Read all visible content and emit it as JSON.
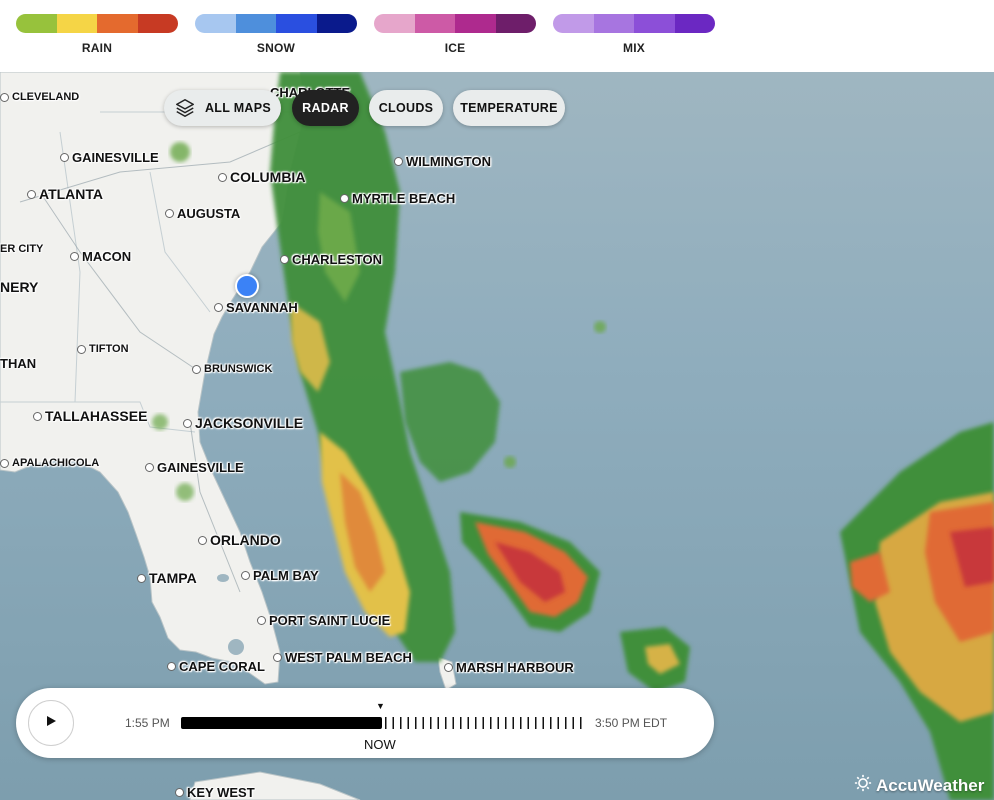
{
  "legend": [
    {
      "label": "RAIN",
      "colors": [
        "#97c23c",
        "#f5d546",
        "#e46a2e",
        "#c73a23"
      ]
    },
    {
      "label": "SNOW",
      "colors": [
        "#a7c7f0",
        "#4e8fdc",
        "#2a4fe0",
        "#0a1a8c"
      ]
    },
    {
      "label": "ICE",
      "colors": [
        "#e6a6cb",
        "#cd5aa6",
        "#ae2a8e",
        "#6e1e6a"
      ]
    },
    {
      "label": "MIX",
      "colors": [
        "#c19ae8",
        "#a775e0",
        "#8c4fd8",
        "#6b28c2"
      ]
    }
  ],
  "map_tabs": {
    "all_maps": "ALL MAPS",
    "radar": "RADAR",
    "clouds": "CLOUDS",
    "temperature": "TEMPERATURE"
  },
  "cities": [
    {
      "id": "charlotte",
      "name": "CHARLOTTE"
    },
    {
      "id": "cleveland",
      "name": "CLEVELAND"
    },
    {
      "id": "gainesville-ga",
      "name": "GAINESVILLE"
    },
    {
      "id": "atlanta",
      "name": "ATLANTA"
    },
    {
      "id": "columbia",
      "name": "COLUMBIA"
    },
    {
      "id": "wilmington",
      "name": "WILMINGTON"
    },
    {
      "id": "myrtle-beach",
      "name": "MYRTLE BEACH"
    },
    {
      "id": "augusta",
      "name": "AUGUSTA"
    },
    {
      "id": "er-city",
      "name": "ER CITY"
    },
    {
      "id": "macon",
      "name": "MACON"
    },
    {
      "id": "charleston",
      "name": "CHARLESTON"
    },
    {
      "id": "nery",
      "name": "NERY"
    },
    {
      "id": "savannah",
      "name": "SAVANNAH"
    },
    {
      "id": "tifton",
      "name": "TIFTON"
    },
    {
      "id": "than",
      "name": "THAN"
    },
    {
      "id": "brunswick",
      "name": "BRUNSWICK"
    },
    {
      "id": "tallahassee",
      "name": "TALLAHASSEE"
    },
    {
      "id": "jacksonville",
      "name": "JACKSONVILLE"
    },
    {
      "id": "apalachicola",
      "name": "APALACHICOLA"
    },
    {
      "id": "gainesville-fl",
      "name": "GAINESVILLE"
    },
    {
      "id": "orlando",
      "name": "ORLANDO"
    },
    {
      "id": "tampa",
      "name": "TAMPA"
    },
    {
      "id": "palm-bay",
      "name": "PALM BAY"
    },
    {
      "id": "port-saint-lucie",
      "name": "PORT SAINT LUCIE"
    },
    {
      "id": "cape-coral",
      "name": "CAPE CORAL"
    },
    {
      "id": "west-palm-beach",
      "name": "WEST PALM BEACH"
    },
    {
      "id": "marsh-harbour",
      "name": "MARSH HARBOUR"
    },
    {
      "id": "key-west",
      "name": "KEY WEST"
    }
  ],
  "timeline": {
    "start_time": "1:55 PM",
    "end_time": "3:50 PM EDT",
    "now_label": "NOW",
    "now_marker": "▼",
    "progress": 0.5
  },
  "brand": {
    "name": "AccuWeather"
  },
  "icons": {
    "layers": "layers-icon",
    "play": "play-icon",
    "sun": "sun-icon"
  }
}
